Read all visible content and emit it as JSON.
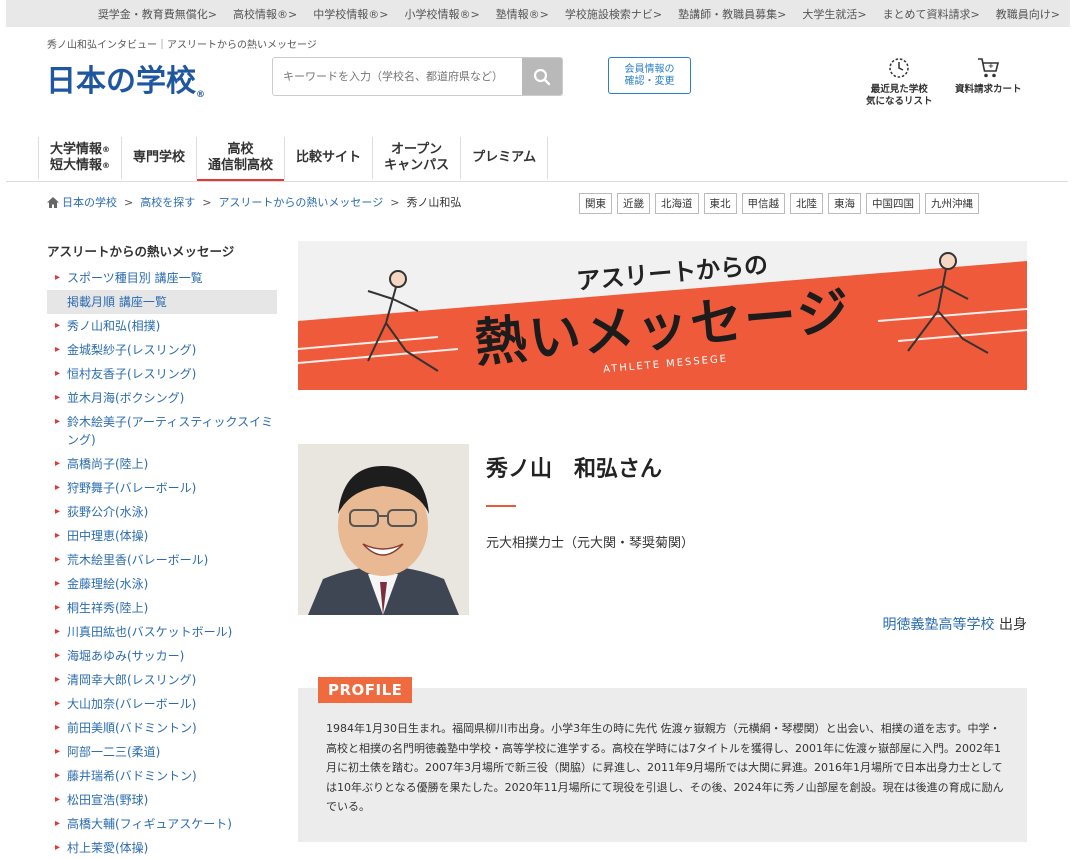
{
  "top_links": [
    "奨学金・教育費無償化>",
    "高校情報®>",
    "中学校情報®>",
    "小学校情報®>",
    "塾情報®>",
    "学校施設検索ナビ>",
    "塾講師・教職員募集>",
    "大学生就活>",
    "まとめて資料請求>",
    "教職員向け>"
  ],
  "header": {
    "tagline": "秀ノ山和弘インタビュー｜アスリートからの熱いメッセージ",
    "logo": "日本の学校",
    "logo_reg": "®",
    "search_placeholder": "キーワードを入力（学校名、都道府県など）",
    "member_line1": "会員情報の",
    "member_line2": "確認・変更",
    "recent_line1": "最近見た学校",
    "recent_line2": "気になるリスト",
    "cart_label": "資料請求カート"
  },
  "gnav": {
    "univ_line1": "大学情報",
    "univ_line2": "短大情報",
    "reg": "®",
    "senmon": "専門学校",
    "koko_line1": "高校",
    "koko_line2": "通信制高校",
    "hikaku": "比較サイト",
    "open_line1": "オープン",
    "open_line2": "キャンパス",
    "premium": "プレミアム"
  },
  "breadcrumb": {
    "home": "日本の学校",
    "sep": ">",
    "search": "高校を探す",
    "section": "アスリートからの熱いメッセージ",
    "current": "秀ノ山和弘"
  },
  "regions": [
    "関東",
    "近畿",
    "北海道",
    "東北",
    "甲信越",
    "北陸",
    "東海",
    "中国四国",
    "九州沖縄"
  ],
  "sidebar": {
    "heading": "アスリートからの熱いメッセージ",
    "items": [
      "スポーツ種目別 講座一覧",
      "掲載月順 講座一覧",
      "秀ノ山和弘(相撲)",
      "金城梨紗子(レスリング)",
      "恒村友香子(レスリング)",
      "並木月海(ボクシング)",
      "鈴木絵美子(アーティスティックスイミング)",
      "高橋尚子(陸上)",
      "狩野舞子(バレーボール)",
      "荻野公介(水泳)",
      "田中理恵(体操)",
      "荒木絵里香(バレーボール)",
      "金藤理絵(水泳)",
      "桐生祥秀(陸上)",
      "川真田紘也(バスケットボール)",
      "海堀あゆみ(サッカー)",
      "清岡幸大郎(レスリング)",
      "大山加奈(バレーボール)",
      "前田美順(バドミントン)",
      "阿部一二三(柔道)",
      "藤井瑞希(バドミントン)",
      "松田宣浩(野球)",
      "高橋大輔(フィギュアスケート)",
      "村上茉愛(体操)"
    ],
    "active_index": 1
  },
  "banner": {
    "line1": "アスリートからの",
    "line2": "熱いメッセージ",
    "line3": "ATHLETE MESSEGE"
  },
  "profile": {
    "name": "秀ノ山　和弘さん",
    "title": "元大相撲力士（元大関・琴奨菊関）",
    "school": "明徳義塾高等学校",
    "school_suffix": " 出身",
    "tag": "PROFILE",
    "text": "1984年1月30日生まれ。福岡県柳川市出身。小学3年生の時に先代 佐渡ヶ嶽親方（元横綱・琴櫻関）と出会い、相撲の道を志す。中学・高校と相撲の名門明徳義塾中学校・高等学校に進学する。高校在学時には7タイトルを獲得し、2001年に佐渡ヶ嶽部屋に入門。2002年1月に初土俵を踏む。2007年3月場所で新三役（関脇）に昇進し、2011年9月場所では大関に昇進。2016年1月場所で日本出身力士としては10年ぶりとなる優勝を果たした。2020年11月場所にて現役を引退し、その後、2024年に秀ノ山部屋を創設。現在は後進の育成に励んでいる。"
  },
  "colors": {
    "brand_blue": "#1e56a0",
    "link_blue": "#2b6cb0",
    "accent_red": "#e23838",
    "profile_orange": "#ef6a3e"
  }
}
